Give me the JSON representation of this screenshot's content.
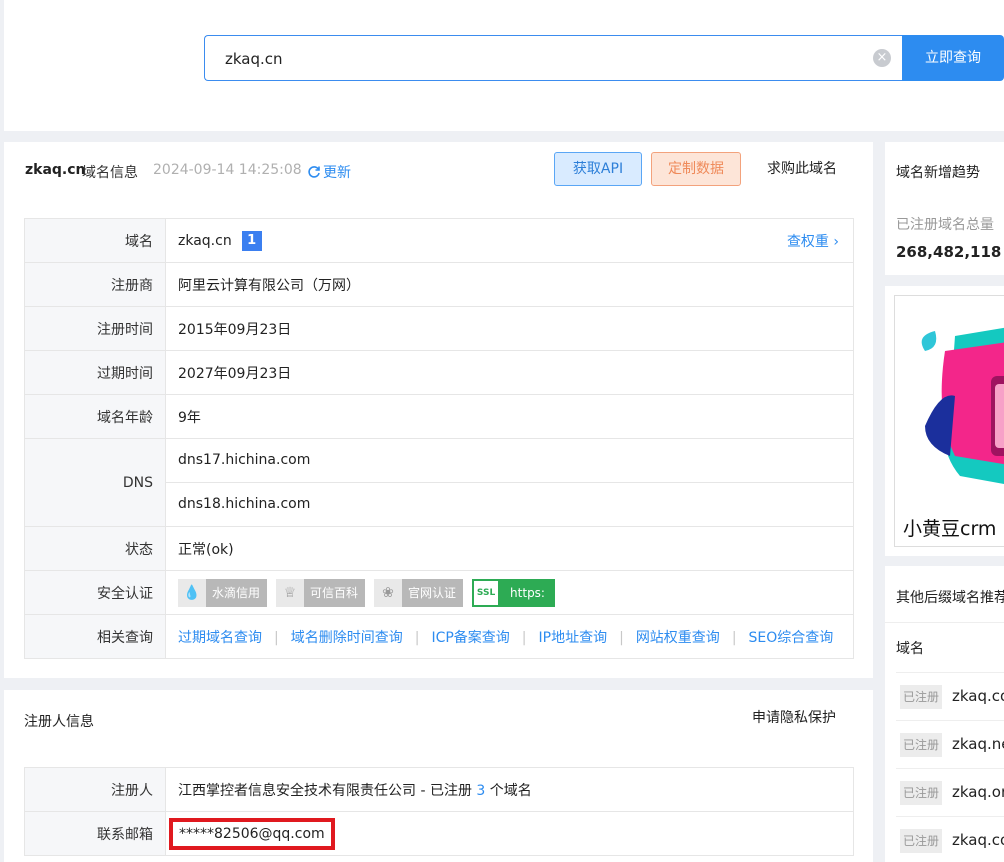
{
  "search": {
    "value": "zkaq.cn",
    "button": "立即查询"
  },
  "info_header": {
    "domain": "zkaq.cn",
    "label": "域名信息",
    "time": "2024-09-14 14:25:08",
    "update": "更新",
    "btn_api": "获取API",
    "btn_custom": "定制数据",
    "btn_buy": "求购此域名"
  },
  "info": {
    "domain_key": "域名",
    "domain_val": "zkaq.cn",
    "domain_badge": "1",
    "weight_link": "查权重",
    "registrar_key": "注册商",
    "registrar_val": "阿里云计算有限公司（万网）",
    "reg_time_key": "注册时间",
    "reg_time_val": "2015年09月23日",
    "exp_time_key": "过期时间",
    "exp_time_val": "2027年09月23日",
    "age_key": "域名年龄",
    "age_val": "9年",
    "dns_key": "DNS",
    "dns": [
      "dns17.hichina.com",
      "dns18.hichina.com"
    ],
    "status_key": "状态",
    "status_val": "正常(ok)",
    "security_key": "安全认证",
    "certs": [
      "水滴信用",
      "可信百科",
      "官网认证",
      "https:"
    ],
    "related_key": "相关查询",
    "related": [
      "过期域名查询",
      "域名删除时间查询",
      "ICP备案查询",
      "IP地址查询",
      "网站权重查询",
      "SEO综合查询"
    ]
  },
  "registrant": {
    "title": "注册人信息",
    "privacy_button": "申请隐私保护",
    "person_key": "注册人",
    "person_val": "江西掌控者信息安全技术有限责任公司 - 已注册 ",
    "person_count": "3",
    "person_suffix": " 个域名",
    "email_key": "联系邮箱",
    "email_val": "*****82506@qq.com"
  },
  "sidebar": {
    "trend_title": "域名新增趋势",
    "total_label": "已注册域名总量",
    "total_value": "268,482,118",
    "ad_caption": "小黄豆crm",
    "suffix_title": "其他后缀域名推荐",
    "suffix_header": "域名",
    "suffix_rows": [
      {
        "tag": "已注册",
        "domain": "zkaq.com"
      },
      {
        "tag": "已注册",
        "domain": "zkaq.net"
      },
      {
        "tag": "已注册",
        "domain": "zkaq.org"
      },
      {
        "tag": "已注册",
        "domain": "zkaq.com"
      }
    ]
  },
  "colors": {
    "accent": "#2d8cf0",
    "highlight": "#e0191f"
  }
}
